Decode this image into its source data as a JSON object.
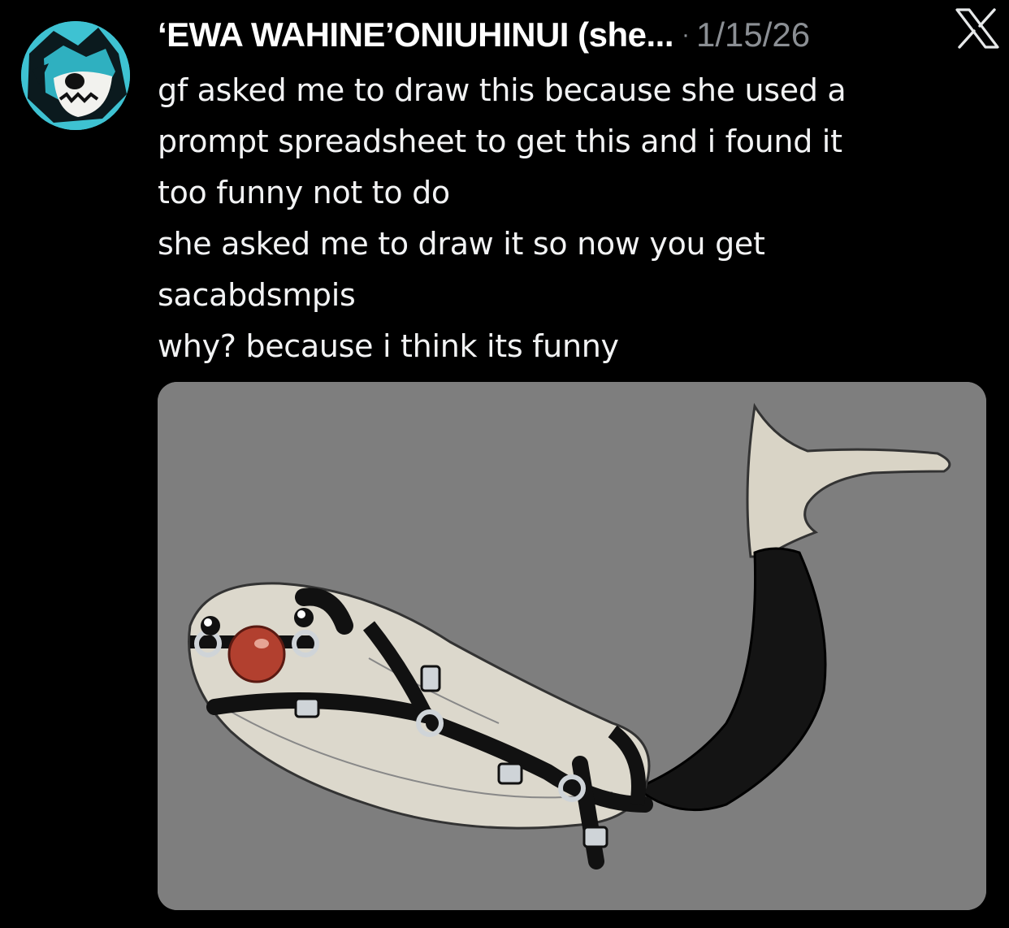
{
  "post": {
    "author": "‘EWA WAHINE’ONIUHINUI (she...",
    "separator": "·",
    "date": "1/15/26",
    "body_lines": [
      "gf asked me to draw this because she used a",
      "prompt spreadsheet to get this and i found it",
      "too funny not to do",
      "she asked me to draw it so now you get",
      "sacabdsmpis",
      "why? because i think its funny"
    ]
  },
  "icons": {
    "avatar": "avatar-shark-icon",
    "platform": "x-logo-icon"
  },
  "colors": {
    "background": "#000000",
    "text": "#e7e9ea",
    "muted": "#8b8f94",
    "avatar_bg": "#3ec2d2",
    "image_bg": "#7e7e7e",
    "gag_ball": "#b2402f"
  }
}
